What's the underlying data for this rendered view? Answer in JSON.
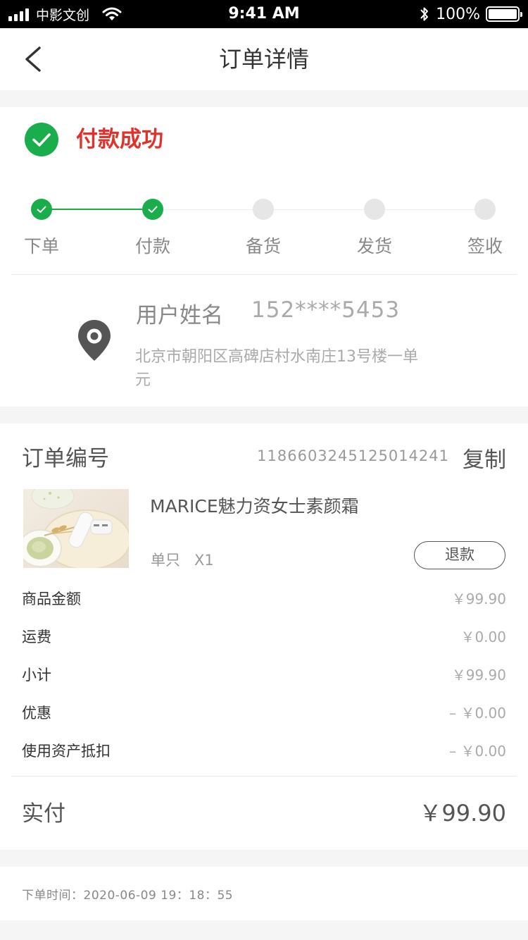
{
  "status_bar": {
    "carrier": "中影文创",
    "time": "9:41 AM",
    "battery": "100%"
  },
  "nav": {
    "title": "订单详情"
  },
  "payment": {
    "status": "付款成功"
  },
  "steps": [
    {
      "label": "下单",
      "done": true
    },
    {
      "label": "付款",
      "done": true
    },
    {
      "label": "备货",
      "done": false
    },
    {
      "label": "发货",
      "done": false
    },
    {
      "label": "签收",
      "done": false
    }
  ],
  "address": {
    "name": "用户姓名",
    "phone": "152****5453",
    "detail": "北京市朝阳区高碑店村水南庄13号楼一单元"
  },
  "order": {
    "number_label": "订单编号",
    "number": "1186603245125014241",
    "copy_label": "复制"
  },
  "product": {
    "name": "MARICE魅力资女士素颜霜",
    "spec": "单只",
    "quantity": "X1",
    "refund_label": "退款"
  },
  "fees": [
    {
      "label": "商品金额",
      "value": "￥99.90"
    },
    {
      "label": "运费",
      "value": "￥0.00"
    },
    {
      "label": "小计",
      "value": "￥99.90"
    },
    {
      "label": "优惠",
      "value": "– ￥0.00"
    },
    {
      "label": "使用资产抵扣",
      "value": "– ￥0.00"
    }
  ],
  "paid": {
    "label": "实付",
    "value": "￥99.90"
  },
  "order_time": "下单时间：2020-06-09 19：18：55",
  "colors": {
    "success": "#1aad4b",
    "status_red": "#e0322b"
  }
}
